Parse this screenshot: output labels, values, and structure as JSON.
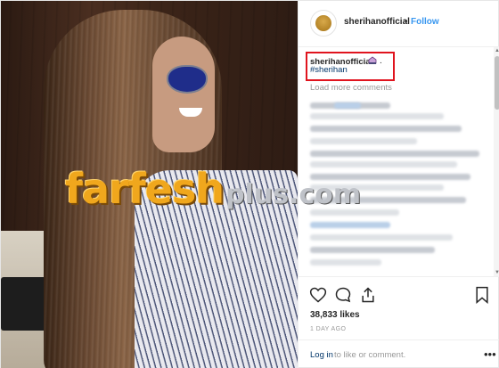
{
  "header": {
    "username": "sherihanofficial",
    "separator": "•",
    "follow_label": "Follow"
  },
  "caption": {
    "username": "sherihanofficial",
    "emoji_icon": "gem-ring-icon",
    "trailing_dot": ".",
    "hashtag": "#sherihan"
  },
  "comments": {
    "load_more_label": "Load more comments"
  },
  "watermark": {
    "brand": "farfesh",
    "suffix": "plus.com"
  },
  "actions": {
    "likes": "38,833 likes",
    "date": "1 DAY AGO",
    "login_link": "Log in",
    "login_rest": "to like or comment.",
    "more_label": "•••"
  },
  "colors": {
    "link_blue": "#3897f0",
    "highlight_red": "#e0141e",
    "watermark_orange": "#f0a71d"
  }
}
